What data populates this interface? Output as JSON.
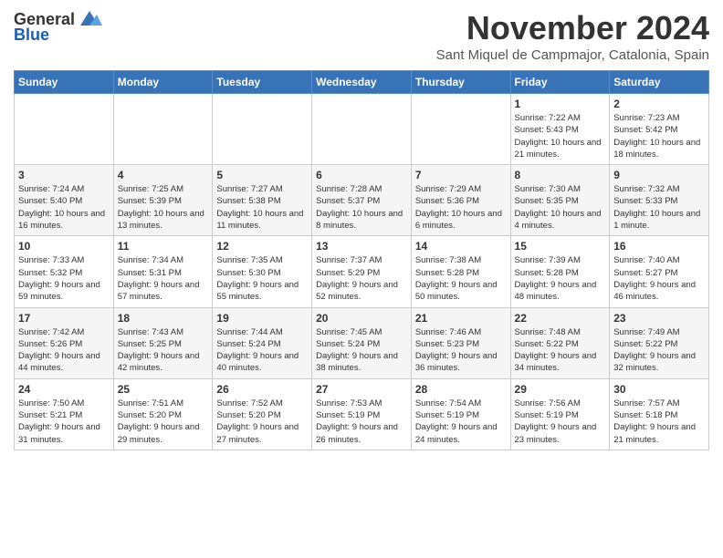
{
  "header": {
    "logo_general": "General",
    "logo_blue": "Blue",
    "month_title": "November 2024",
    "subtitle": "Sant Miquel de Campmajor, Catalonia, Spain"
  },
  "days_of_week": [
    "Sunday",
    "Monday",
    "Tuesday",
    "Wednesday",
    "Thursday",
    "Friday",
    "Saturday"
  ],
  "weeks": [
    [
      {
        "day": "",
        "info": ""
      },
      {
        "day": "",
        "info": ""
      },
      {
        "day": "",
        "info": ""
      },
      {
        "day": "",
        "info": ""
      },
      {
        "day": "",
        "info": ""
      },
      {
        "day": "1",
        "info": "Sunrise: 7:22 AM\nSunset: 5:43 PM\nDaylight: 10 hours and 21 minutes."
      },
      {
        "day": "2",
        "info": "Sunrise: 7:23 AM\nSunset: 5:42 PM\nDaylight: 10 hours and 18 minutes."
      }
    ],
    [
      {
        "day": "3",
        "info": "Sunrise: 7:24 AM\nSunset: 5:40 PM\nDaylight: 10 hours and 16 minutes."
      },
      {
        "day": "4",
        "info": "Sunrise: 7:25 AM\nSunset: 5:39 PM\nDaylight: 10 hours and 13 minutes."
      },
      {
        "day": "5",
        "info": "Sunrise: 7:27 AM\nSunset: 5:38 PM\nDaylight: 10 hours and 11 minutes."
      },
      {
        "day": "6",
        "info": "Sunrise: 7:28 AM\nSunset: 5:37 PM\nDaylight: 10 hours and 8 minutes."
      },
      {
        "day": "7",
        "info": "Sunrise: 7:29 AM\nSunset: 5:36 PM\nDaylight: 10 hours and 6 minutes."
      },
      {
        "day": "8",
        "info": "Sunrise: 7:30 AM\nSunset: 5:35 PM\nDaylight: 10 hours and 4 minutes."
      },
      {
        "day": "9",
        "info": "Sunrise: 7:32 AM\nSunset: 5:33 PM\nDaylight: 10 hours and 1 minute."
      }
    ],
    [
      {
        "day": "10",
        "info": "Sunrise: 7:33 AM\nSunset: 5:32 PM\nDaylight: 9 hours and 59 minutes."
      },
      {
        "day": "11",
        "info": "Sunrise: 7:34 AM\nSunset: 5:31 PM\nDaylight: 9 hours and 57 minutes."
      },
      {
        "day": "12",
        "info": "Sunrise: 7:35 AM\nSunset: 5:30 PM\nDaylight: 9 hours and 55 minutes."
      },
      {
        "day": "13",
        "info": "Sunrise: 7:37 AM\nSunset: 5:29 PM\nDaylight: 9 hours and 52 minutes."
      },
      {
        "day": "14",
        "info": "Sunrise: 7:38 AM\nSunset: 5:28 PM\nDaylight: 9 hours and 50 minutes."
      },
      {
        "day": "15",
        "info": "Sunrise: 7:39 AM\nSunset: 5:28 PM\nDaylight: 9 hours and 48 minutes."
      },
      {
        "day": "16",
        "info": "Sunrise: 7:40 AM\nSunset: 5:27 PM\nDaylight: 9 hours and 46 minutes."
      }
    ],
    [
      {
        "day": "17",
        "info": "Sunrise: 7:42 AM\nSunset: 5:26 PM\nDaylight: 9 hours and 44 minutes."
      },
      {
        "day": "18",
        "info": "Sunrise: 7:43 AM\nSunset: 5:25 PM\nDaylight: 9 hours and 42 minutes."
      },
      {
        "day": "19",
        "info": "Sunrise: 7:44 AM\nSunset: 5:24 PM\nDaylight: 9 hours and 40 minutes."
      },
      {
        "day": "20",
        "info": "Sunrise: 7:45 AM\nSunset: 5:24 PM\nDaylight: 9 hours and 38 minutes."
      },
      {
        "day": "21",
        "info": "Sunrise: 7:46 AM\nSunset: 5:23 PM\nDaylight: 9 hours and 36 minutes."
      },
      {
        "day": "22",
        "info": "Sunrise: 7:48 AM\nSunset: 5:22 PM\nDaylight: 9 hours and 34 minutes."
      },
      {
        "day": "23",
        "info": "Sunrise: 7:49 AM\nSunset: 5:22 PM\nDaylight: 9 hours and 32 minutes."
      }
    ],
    [
      {
        "day": "24",
        "info": "Sunrise: 7:50 AM\nSunset: 5:21 PM\nDaylight: 9 hours and 31 minutes."
      },
      {
        "day": "25",
        "info": "Sunrise: 7:51 AM\nSunset: 5:20 PM\nDaylight: 9 hours and 29 minutes."
      },
      {
        "day": "26",
        "info": "Sunrise: 7:52 AM\nSunset: 5:20 PM\nDaylight: 9 hours and 27 minutes."
      },
      {
        "day": "27",
        "info": "Sunrise: 7:53 AM\nSunset: 5:19 PM\nDaylight: 9 hours and 26 minutes."
      },
      {
        "day": "28",
        "info": "Sunrise: 7:54 AM\nSunset: 5:19 PM\nDaylight: 9 hours and 24 minutes."
      },
      {
        "day": "29",
        "info": "Sunrise: 7:56 AM\nSunset: 5:19 PM\nDaylight: 9 hours and 23 minutes."
      },
      {
        "day": "30",
        "info": "Sunrise: 7:57 AM\nSunset: 5:18 PM\nDaylight: 9 hours and 21 minutes."
      }
    ]
  ]
}
